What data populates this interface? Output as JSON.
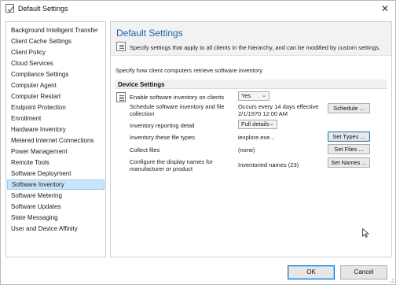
{
  "window": {
    "title": "Default Settings",
    "close_glyph": "✕"
  },
  "sidebar": {
    "items": [
      {
        "label": "Background Intelligent Transfer"
      },
      {
        "label": "Client Cache Settings"
      },
      {
        "label": "Client Policy"
      },
      {
        "label": "Cloud Services"
      },
      {
        "label": "Compliance Settings"
      },
      {
        "label": "Computer Agent"
      },
      {
        "label": "Computer Restart"
      },
      {
        "label": "Endpoint Protection"
      },
      {
        "label": "Enrollment"
      },
      {
        "label": "Hardware Inventory"
      },
      {
        "label": "Metered Internet Connections"
      },
      {
        "label": "Power Management"
      },
      {
        "label": "Remote Tools"
      },
      {
        "label": "Software Deployment"
      },
      {
        "label": "Software Inventory",
        "selected": true
      },
      {
        "label": "Software Metering"
      },
      {
        "label": "Software Updates"
      },
      {
        "label": "State Messaging"
      },
      {
        "label": "User and Device Affinity"
      }
    ]
  },
  "main": {
    "title": "Default Settings",
    "description": "Specify settings that apply to all clients in the hierarchy, and can be modified by custom settings.",
    "subtitle": "Specify how client computers retrieve software inventory",
    "group_title": "Device Settings",
    "settings": {
      "enable": {
        "label": "Enable software inventory on clients",
        "value": "Yes"
      },
      "schedule": {
        "label_1": "Schedule software inventory and file",
        "label_2": "collection",
        "value_1": "Occurs every 14 days effective",
        "value_2": "2/1/1970 12:00 AM",
        "button": "Schedule ..."
      },
      "detail": {
        "label": "Inventory reporting detail",
        "value": "Full details"
      },
      "file_types": {
        "label": "Inventory these file types",
        "value": "iexplore.exe...",
        "button": "Set Types ..."
      },
      "collect": {
        "label": "Collect files",
        "value": "(none)",
        "button": "Set Files ..."
      },
      "names": {
        "label_1": "Configure the display names for",
        "label_2": "manufacturer or product",
        "value": "Inventoried names (23)",
        "button": "Set Names ..."
      }
    }
  },
  "footer": {
    "ok": "OK",
    "cancel": "Cancel"
  },
  "icons": {
    "chevron": "⌄"
  },
  "colors": {
    "accent_title": "#1f5fa8",
    "selected_bg": "#cce4f7",
    "selected_border": "#99c9ef",
    "focus_border": "#0078d7"
  }
}
